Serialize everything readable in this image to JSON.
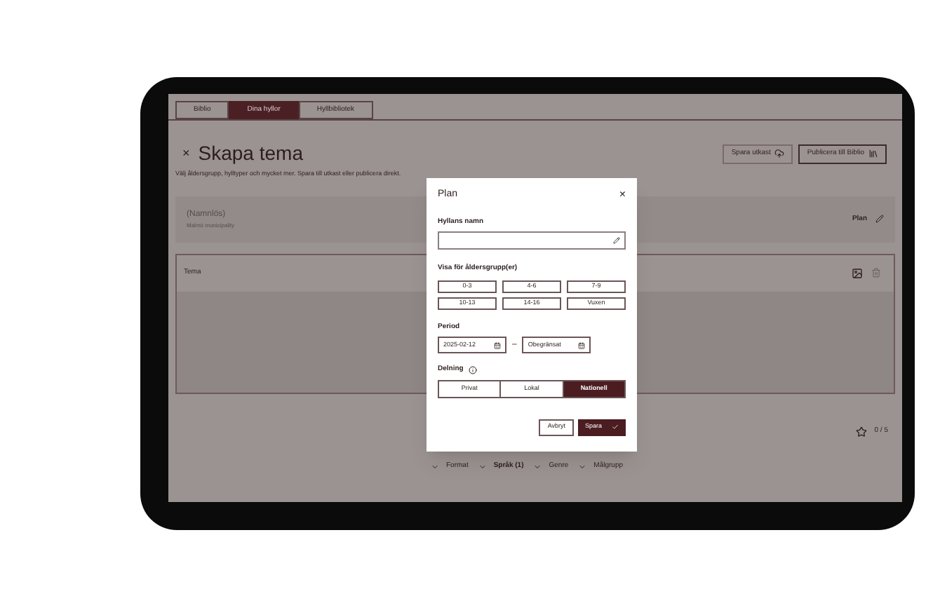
{
  "tabs": [
    {
      "label": "Biblio",
      "selected": false
    },
    {
      "label": "Dina hyllor",
      "selected": true
    },
    {
      "label": "Hyllbibliotek",
      "selected": false
    }
  ],
  "header": {
    "close": "×",
    "title": "Skapa tema",
    "subtitle": "Välj åldersgrupp, hylltyper och mycket mer. Spara till utkast eller publicera direkt.",
    "actions": [
      "Spara utkast",
      "Publicera till Biblio"
    ]
  },
  "shelf": {
    "name": "(Namnlös)",
    "owner": "Malmö municipality",
    "plan": "Plan"
  },
  "theme_card": {
    "title": "Tema"
  },
  "rating": "0 / 5",
  "filters": [
    {
      "label": "Format",
      "active": false
    },
    {
      "label": "Språk (1)",
      "active": true
    },
    {
      "label": "Genre",
      "active": false
    },
    {
      "label": "Målgrupp",
      "active": false
    }
  ],
  "dialog": {
    "title": "Plan",
    "close": "×",
    "name_label": "Hyllans namn",
    "age_label": "Visa för åldersgrupp(er)",
    "ages": [
      {
        "label": "0-3",
        "selected": false
      },
      {
        "label": "4-6",
        "selected": false
      },
      {
        "label": "7-9",
        "selected": false
      },
      {
        "label": "10-13",
        "selected": false
      },
      {
        "label": "14-16",
        "selected": false
      },
      {
        "label": "Vuxen",
        "selected": false
      }
    ],
    "period_label": "Period",
    "start": "2025-02-12",
    "dash": "–",
    "end": "Obegränsat",
    "sharing_label": "Delning",
    "sharing": [
      {
        "label": "Privat",
        "selected": false
      },
      {
        "label": "Lokal",
        "selected": false
      },
      {
        "label": "Nationell",
        "selected": true
      }
    ],
    "cancel": "Avbryt",
    "save": "Spara"
  }
}
